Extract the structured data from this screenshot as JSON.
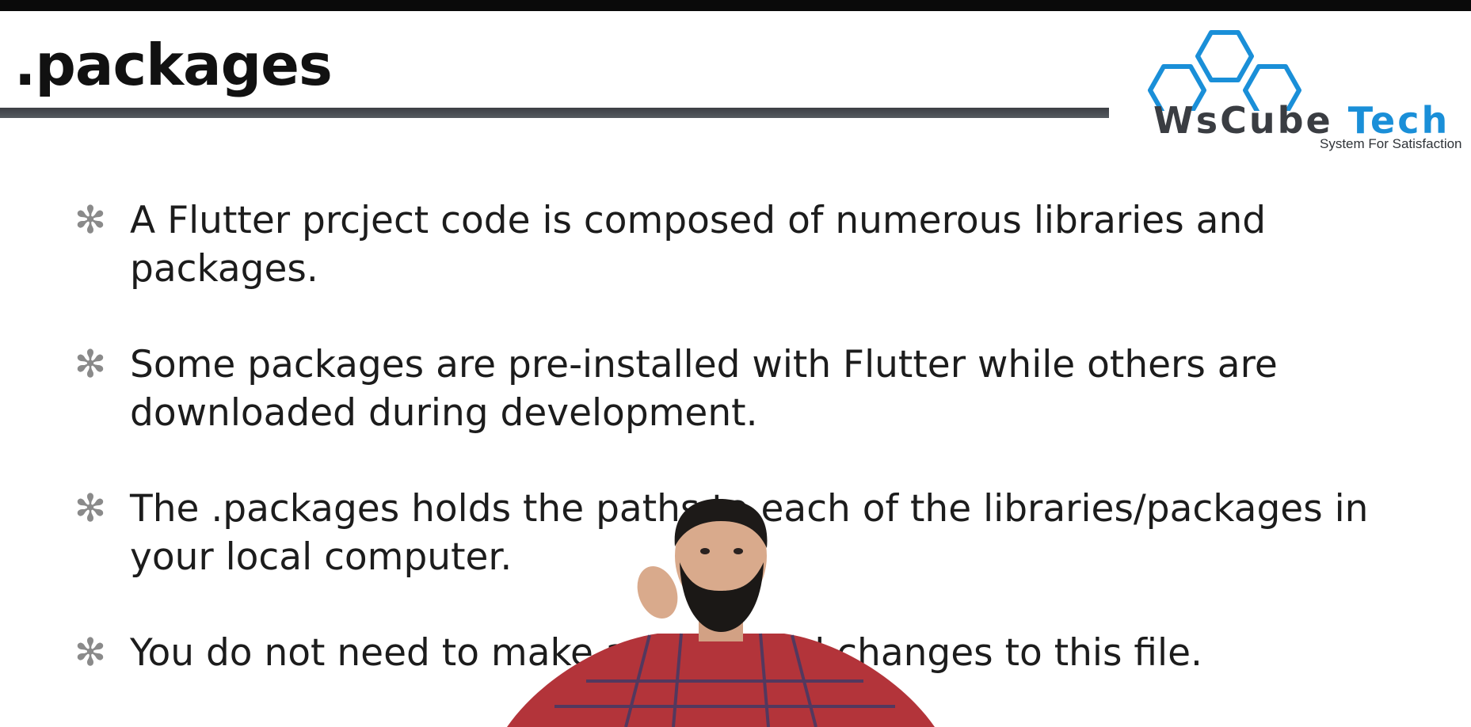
{
  "slide": {
    "title": ".packages"
  },
  "logo": {
    "brand_first": "WsCube",
    "brand_second": "Tech",
    "tagline": "System For Satisfaction",
    "brand_color": "#1a8fd8",
    "dark_color": "#3a3d42"
  },
  "bullets": [
    {
      "icon": "asterisk-bullet-icon",
      "text": "A Flutter prcject code is composed of numerous libraries and packages."
    },
    {
      "icon": "asterisk-bullet-icon",
      "text": "Some packages are pre-installed with Flutter while others are downloaded during development."
    },
    {
      "icon": "asterisk-bullet-icon",
      "text": "The .packages holds the paths to each of the libraries/packages in your local computer."
    },
    {
      "icon": "asterisk-bullet-icon",
      "text": "You do not need to make any manual changes to this file."
    }
  ],
  "bullet_glyph": "✻"
}
